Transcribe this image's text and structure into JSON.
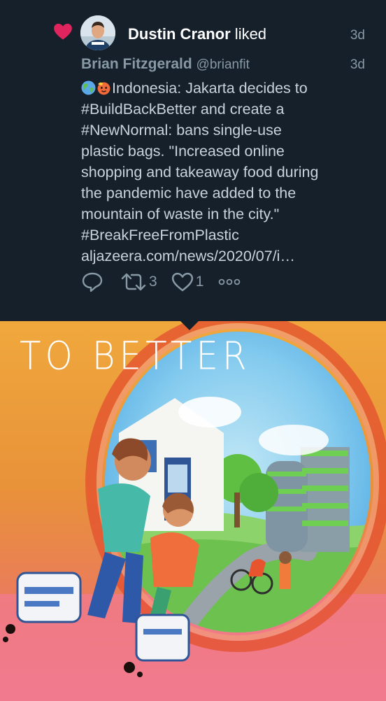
{
  "notification": {
    "liker_name": "Dustin Cranor",
    "action_text": " liked",
    "time": "3d",
    "icon": "heart-icon",
    "avatar_icon": "avatar-icon"
  },
  "tweet": {
    "author_name": "Brian Fitzgerald",
    "author_handle": "@brianfit",
    "time": "3d",
    "emojis": [
      "globe-icon",
      "hot-face-icon"
    ],
    "lines": [
      "Indonesia: Jakarta decides to",
      "#BuildBackBetter and create a",
      "#NewNormal: bans single-use",
      "plastic bags. \"Increased online",
      "shopping and takeaway food during",
      "the pandemic have added to the",
      "mountain of waste in the city.\"",
      "#BreakFreeFromPlastic",
      "aljazeera.com/news/2020/07/i…"
    ],
    "actions": {
      "reply_icon": "reply-icon",
      "retweet_icon": "retweet-icon",
      "retweet_count": "3",
      "like_icon": "heart-outline-icon",
      "like_count": "1",
      "more_icon": "more-icon"
    }
  },
  "media": {
    "caption": "TO BETTER",
    "image_icon": "illustration-image"
  },
  "colors": {
    "background": "#16202b",
    "heart": "#e0245e",
    "name_text": "#ffffff",
    "secondary_text": "#8899a6",
    "body_text": "#c9d3dc"
  }
}
